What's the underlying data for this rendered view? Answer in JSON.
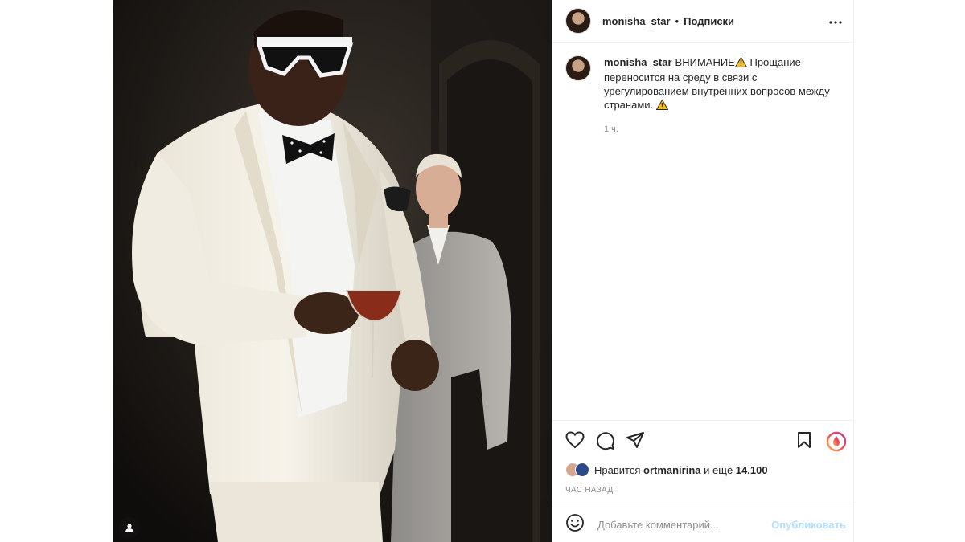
{
  "post": {
    "username": "monisha_star",
    "separator": "•",
    "follow_label": "Подписки"
  },
  "caption": {
    "username": "monisha_star",
    "text_head": "ВНИМАНИЕ",
    "text_body": "Прощание переносится на среду в связи с урегулированием внутренних вопросов между странами.",
    "time": "1 ч."
  },
  "likes": {
    "prefix": "Нравится",
    "user": "ortmanirina",
    "middle": "и ещё",
    "count": "14,100"
  },
  "timestamp": "ЧАС НАЗАД",
  "comment": {
    "placeholder": "Добавьте комментарий...",
    "publish_label": "Опубликовать"
  },
  "colors": {
    "accent_publish": "#b2dffc",
    "muted_text": "#8e8e8e",
    "warning": "#f6c40f"
  },
  "icons": [
    "more-icon",
    "heart-icon",
    "comment-icon",
    "share-icon",
    "bookmark-icon",
    "ring-icon",
    "smiley-icon",
    "user-tag-icon",
    "warning-icon"
  ]
}
